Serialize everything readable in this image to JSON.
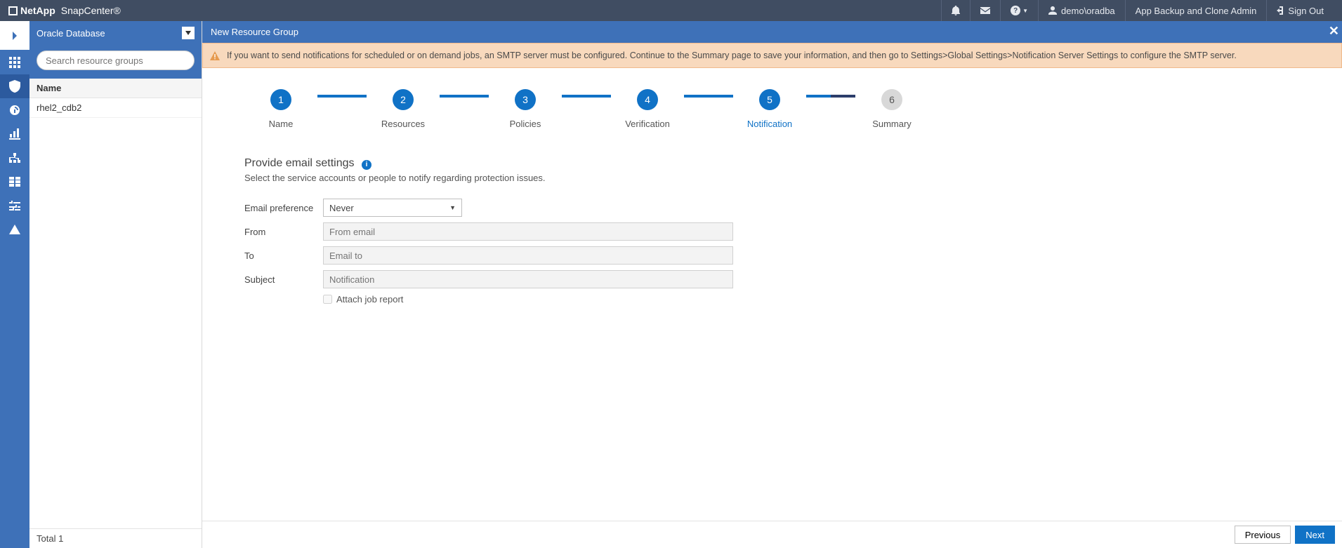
{
  "header": {
    "brand": "NetApp",
    "product": "SnapCenter®",
    "user": "demo\\oradba",
    "role": "App Backup and Clone Admin",
    "signout": "Sign Out"
  },
  "leftpanel": {
    "scope": "Oracle Database",
    "search_placeholder": "Search resource groups",
    "col_header": "Name",
    "rows": [
      "rhel2_cdb2"
    ],
    "total_label": "Total 1"
  },
  "main": {
    "title": "New Resource Group",
    "notice": "If you want to send notifications for scheduled or on demand jobs, an SMTP server must be configured. Continue to the Summary page to save your information, and then go to Settings>Global Settings>Notification Server Settings to configure the SMTP server."
  },
  "stepper": [
    {
      "n": "1",
      "label": "Name",
      "state": "done"
    },
    {
      "n": "2",
      "label": "Resources",
      "state": "done"
    },
    {
      "n": "3",
      "label": "Policies",
      "state": "done"
    },
    {
      "n": "4",
      "label": "Verification",
      "state": "done"
    },
    {
      "n": "5",
      "label": "Notification",
      "state": "current"
    },
    {
      "n": "6",
      "label": "Summary",
      "state": "future"
    }
  ],
  "form": {
    "section_title": "Provide email settings",
    "section_sub": "Select the service accounts or people to notify regarding protection issues.",
    "rows": {
      "email_pref_label": "Email preference",
      "email_pref_value": "Never",
      "from_label": "From",
      "from_placeholder": "From email",
      "to_label": "To",
      "to_placeholder": "Email to",
      "subject_label": "Subject",
      "subject_placeholder": "Notification",
      "attach_label": "Attach job report"
    }
  },
  "buttons": {
    "previous": "Previous",
    "next": "Next"
  }
}
